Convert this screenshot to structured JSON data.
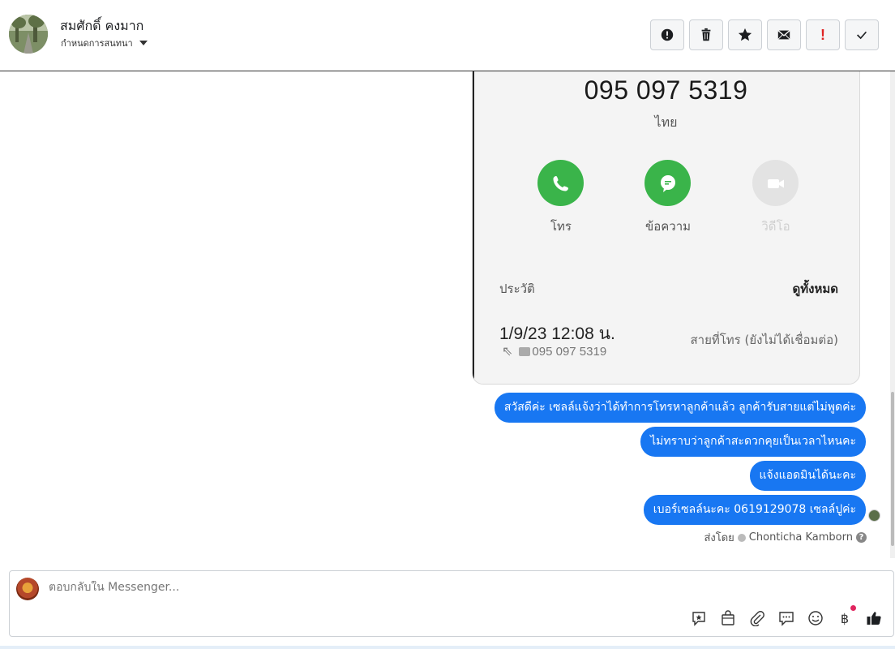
{
  "header": {
    "contact_name": "สมศักดิ์ คงมาก",
    "assign_label": "กำหนดการสนทนา",
    "actions": [
      {
        "name": "spam-button",
        "icon": "alert-circle-icon"
      },
      {
        "name": "delete-button",
        "icon": "trash-icon"
      },
      {
        "name": "star-button",
        "icon": "star-icon"
      },
      {
        "name": "mark-unread-button",
        "icon": "envelope-icon"
      },
      {
        "name": "follow-up-button",
        "icon": "exclamation-icon",
        "label": "!"
      },
      {
        "name": "mark-done-button",
        "icon": "check-icon"
      }
    ]
  },
  "phone_screenshot": {
    "number": "095 097 5319",
    "country": "ไทย",
    "call_label": "โทร",
    "message_label": "ข้อความ",
    "video_label": "วิดีโอ",
    "history_title": "ประวัติ",
    "view_all": "ดูทั้งหมด",
    "call_datetime": "1/9/23 12:08 น.",
    "call_status": "สายที่โทร (ยังไม่ได้เชื่อมต่อ)",
    "call_number": "095 097 5319",
    "colors": {
      "green": "#3ab44a",
      "grey": "#e3e3e3"
    }
  },
  "messages": [
    "สวัสดีค่ะ เซลล์แจ้งว่าได้ทำการโทรหาลูกค้าแล้ว ลูกค้ารับสายแต่ไม่พูดค่ะ",
    "ไม่ทราบว่าลูกค้าสะดวกคุยเป็นเวลาไหนคะ",
    "แจ้งแอดมินได้นะคะ",
    "เบอร์เซลล์นะคะ 0619129078 เซลล์ปูค่ะ"
  ],
  "sent_by": {
    "prefix": "ส่งโดย",
    "name": "Chonticha Kamborn"
  },
  "composer": {
    "placeholder": "ตอบกลับใน Messenger...",
    "tools": [
      "saved-replies-icon",
      "shop-bag-icon",
      "attachment-icon",
      "chat-bubble-icon",
      "emoji-icon",
      "baht-icon",
      "thumbs-up-icon"
    ],
    "baht_symbol": "฿"
  },
  "colors": {
    "bubble": "#1877f2",
    "accent": "#1877f2"
  }
}
